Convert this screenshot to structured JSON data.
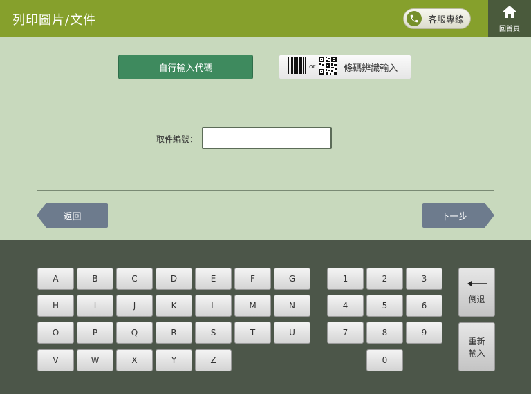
{
  "header": {
    "title": "列印圖片/文件",
    "customer_service": "客服專線",
    "home": "回首頁"
  },
  "modes": {
    "manual": "自行輸入代碼",
    "barcode_or": "or",
    "barcode": "條碼辨識輸入"
  },
  "form": {
    "label": "取件編號：",
    "value": ""
  },
  "nav": {
    "back": "返回",
    "next": "下一步"
  },
  "keyboard": {
    "letters": [
      "A",
      "B",
      "C",
      "D",
      "E",
      "F",
      "G",
      "H",
      "I",
      "J",
      "K",
      "L",
      "M",
      "N",
      "O",
      "P",
      "Q",
      "R",
      "S",
      "T",
      "U",
      "V",
      "W",
      "X",
      "Y",
      "Z"
    ],
    "digits": [
      "1",
      "2",
      "3",
      "4",
      "5",
      "6",
      "7",
      "8",
      "9",
      "0"
    ],
    "backspace": "倒退",
    "reset_line1": "重新",
    "reset_line2": "輸入"
  },
  "colors": {
    "header": "#86a02c",
    "accent": "#3e8a5e",
    "background": "#c8d9bd",
    "keyboard_bg": "#4c5649",
    "nav_button": "#6d7b8d"
  }
}
